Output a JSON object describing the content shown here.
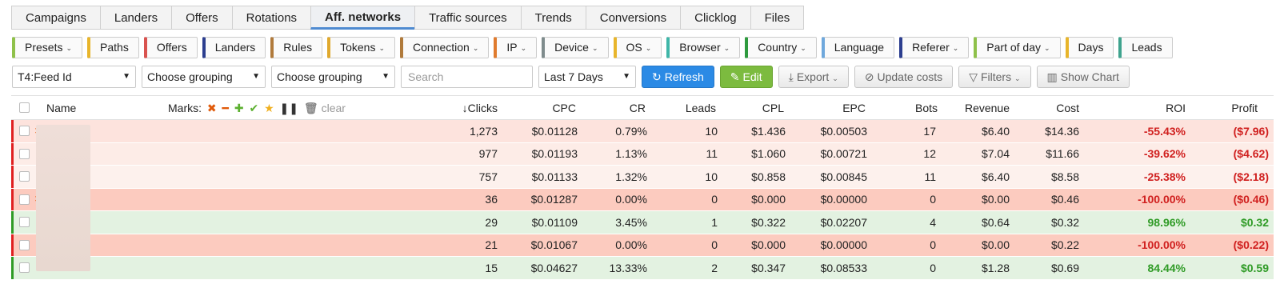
{
  "tabs": [
    "Campaigns",
    "Landers",
    "Offers",
    "Rotations",
    "Aff. networks",
    "Traffic sources",
    "Trends",
    "Conversions",
    "Clicklog",
    "Files"
  ],
  "active_tab": "Aff. networks",
  "chips": [
    {
      "label": "Presets",
      "dropdown": true,
      "color": "#8fc14a"
    },
    {
      "label": "Paths",
      "dropdown": false,
      "color": "#e8b52b"
    },
    {
      "label": "Offers",
      "dropdown": false,
      "color": "#d9534f"
    },
    {
      "label": "Landers",
      "dropdown": false,
      "color": "#2c3e8f"
    },
    {
      "label": "Rules",
      "dropdown": false,
      "color": "#b07a3b"
    },
    {
      "label": "Tokens",
      "dropdown": true,
      "color": "#e0a92e"
    },
    {
      "label": "Connection",
      "dropdown": true,
      "color": "#b07a3b"
    },
    {
      "label": "IP",
      "dropdown": true,
      "color": "#e07b2e"
    },
    {
      "label": "Device",
      "dropdown": true,
      "color": "#7f8c8d"
    },
    {
      "label": "OS",
      "dropdown": true,
      "color": "#e8b52b"
    },
    {
      "label": "Browser",
      "dropdown": true,
      "color": "#3fb6a8"
    },
    {
      "label": "Country",
      "dropdown": true,
      "color": "#2e9a3e"
    },
    {
      "label": "Language",
      "dropdown": false,
      "color": "#6fa8dc"
    },
    {
      "label": "Referer",
      "dropdown": true,
      "color": "#2c3e8f"
    },
    {
      "label": "Part of day",
      "dropdown": true,
      "color": "#8fc14a"
    },
    {
      "label": "Days",
      "dropdown": false,
      "color": "#e8b52b"
    },
    {
      "label": "Leads",
      "dropdown": false,
      "color": "#3fa38e"
    }
  ],
  "controls": {
    "group1": "T4:Feed Id",
    "group2": "Choose grouping",
    "group3": "Choose grouping",
    "search_placeholder": "Search",
    "date_range": "Last 7 Days",
    "refresh": "Refresh",
    "edit": "Edit",
    "export": "Export",
    "update_costs": "Update costs",
    "filters": "Filters",
    "show_chart": "Show Chart"
  },
  "marks_label": "Marks:",
  "marks_clear": "clear",
  "columns": [
    "Name",
    "Clicks",
    "CPC",
    "CR",
    "Leads",
    "CPL",
    "EPC",
    "Bots",
    "Revenue",
    "Cost",
    "ROI",
    "Profit"
  ],
  "rows": [
    {
      "clicks": "1,273",
      "cpc": "$0.01128",
      "cr": "0.79%",
      "leads": "10",
      "cpl": "$1.436",
      "epc": "$0.00503",
      "bots": "17",
      "revenue": "$6.40",
      "cost": "$14.36",
      "roi": "-55.43%",
      "profit": "($7.96)",
      "status": "neg",
      "bg": "#fde3dd",
      "bar": "#e02020",
      "marked": true
    },
    {
      "clicks": "977",
      "cpc": "$0.01193",
      "cr": "1.13%",
      "leads": "11",
      "cpl": "$1.060",
      "epc": "$0.00721",
      "bots": "12",
      "revenue": "$7.04",
      "cost": "$11.66",
      "roi": "-39.62%",
      "profit": "($4.62)",
      "status": "neg",
      "bg": "#fdece7",
      "bar": "#e02020",
      "marked": false
    },
    {
      "clicks": "757",
      "cpc": "$0.01133",
      "cr": "1.32%",
      "leads": "10",
      "cpl": "$0.858",
      "epc": "$0.00845",
      "bots": "11",
      "revenue": "$6.40",
      "cost": "$8.58",
      "roi": "-25.38%",
      "profit": "($2.18)",
      "status": "neg",
      "bg": "#fdf1ed",
      "bar": "#e02020",
      "marked": false
    },
    {
      "clicks": "36",
      "cpc": "$0.01287",
      "cr": "0.00%",
      "leads": "0",
      "cpl": "$0.000",
      "epc": "$0.00000",
      "bots": "0",
      "revenue": "$0.00",
      "cost": "$0.46",
      "roi": "-100.00%",
      "profit": "($0.46)",
      "status": "neg",
      "bg": "#fccbbf",
      "bar": "#e02020",
      "marked": true
    },
    {
      "clicks": "29",
      "cpc": "$0.01109",
      "cr": "3.45%",
      "leads": "1",
      "cpl": "$0.322",
      "epc": "$0.02207",
      "bots": "4",
      "revenue": "$0.64",
      "cost": "$0.32",
      "roi": "98.96%",
      "profit": "$0.32",
      "status": "pos",
      "bg": "#e3f2e1",
      "bar": "#2f9b26",
      "marked": false
    },
    {
      "clicks": "21",
      "cpc": "$0.01067",
      "cr": "0.00%",
      "leads": "0",
      "cpl": "$0.000",
      "epc": "$0.00000",
      "bots": "0",
      "revenue": "$0.00",
      "cost": "$0.22",
      "roi": "-100.00%",
      "profit": "($0.22)",
      "status": "neg",
      "bg": "#fccbbf",
      "bar": "#e02020",
      "marked": false
    },
    {
      "clicks": "15",
      "cpc": "$0.04627",
      "cr": "13.33%",
      "leads": "2",
      "cpl": "$0.347",
      "epc": "$0.08533",
      "bots": "0",
      "revenue": "$1.28",
      "cost": "$0.69",
      "roi": "84.44%",
      "profit": "$0.59",
      "status": "pos",
      "bg": "#e3f2e1",
      "bar": "#2f9b26",
      "marked": false
    }
  ]
}
